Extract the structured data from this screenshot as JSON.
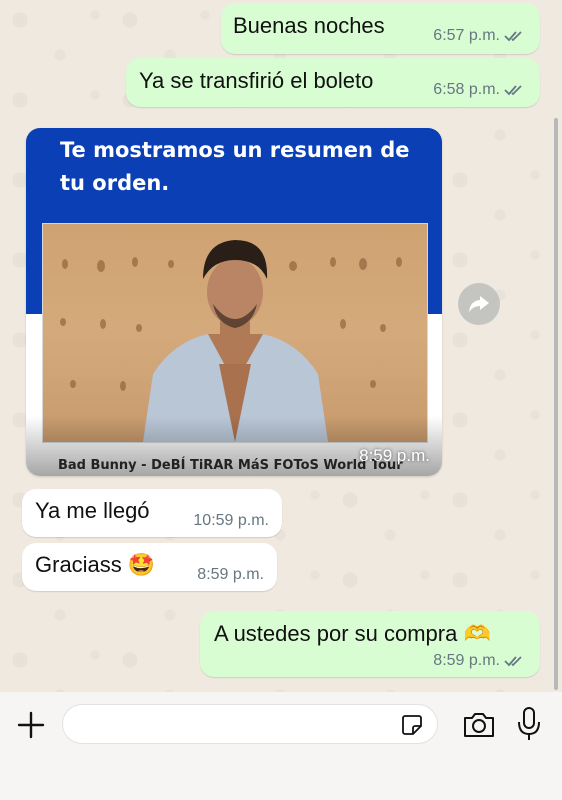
{
  "messages": [
    {
      "text": "Buenas noches",
      "time": "6:57 p.m."
    },
    {
      "text": "Ya se transfirió el boleto",
      "time": "6:58 p.m."
    },
    {
      "card": {
        "heading": "Te mostramos un resumen de tu orden.",
        "event_title": "Bad Bunny - DeBÍ TiRAR MáS FOToS World Tour",
        "time": "8:59 p.m."
      }
    },
    {
      "text": "Ya me llegó",
      "time": "10:59 p.m."
    },
    {
      "text": "Graciass",
      "emoji": "🤩",
      "time": "8:59 p.m."
    },
    {
      "text": "A ustedes por su compra",
      "emoji": "🫶",
      "time": "8:59 p.m."
    }
  ],
  "composer": {
    "placeholder": ""
  },
  "icons": [
    "double-check-icon",
    "forward-icon",
    "plus-icon",
    "sticker-icon",
    "camera-icon",
    "microphone-icon"
  ],
  "colors": {
    "outgoing_bubble": "#d9fdd3",
    "incoming_bubble": "#ffffff",
    "card_header": "#0b3fb5",
    "read_ticks": "#667781"
  }
}
